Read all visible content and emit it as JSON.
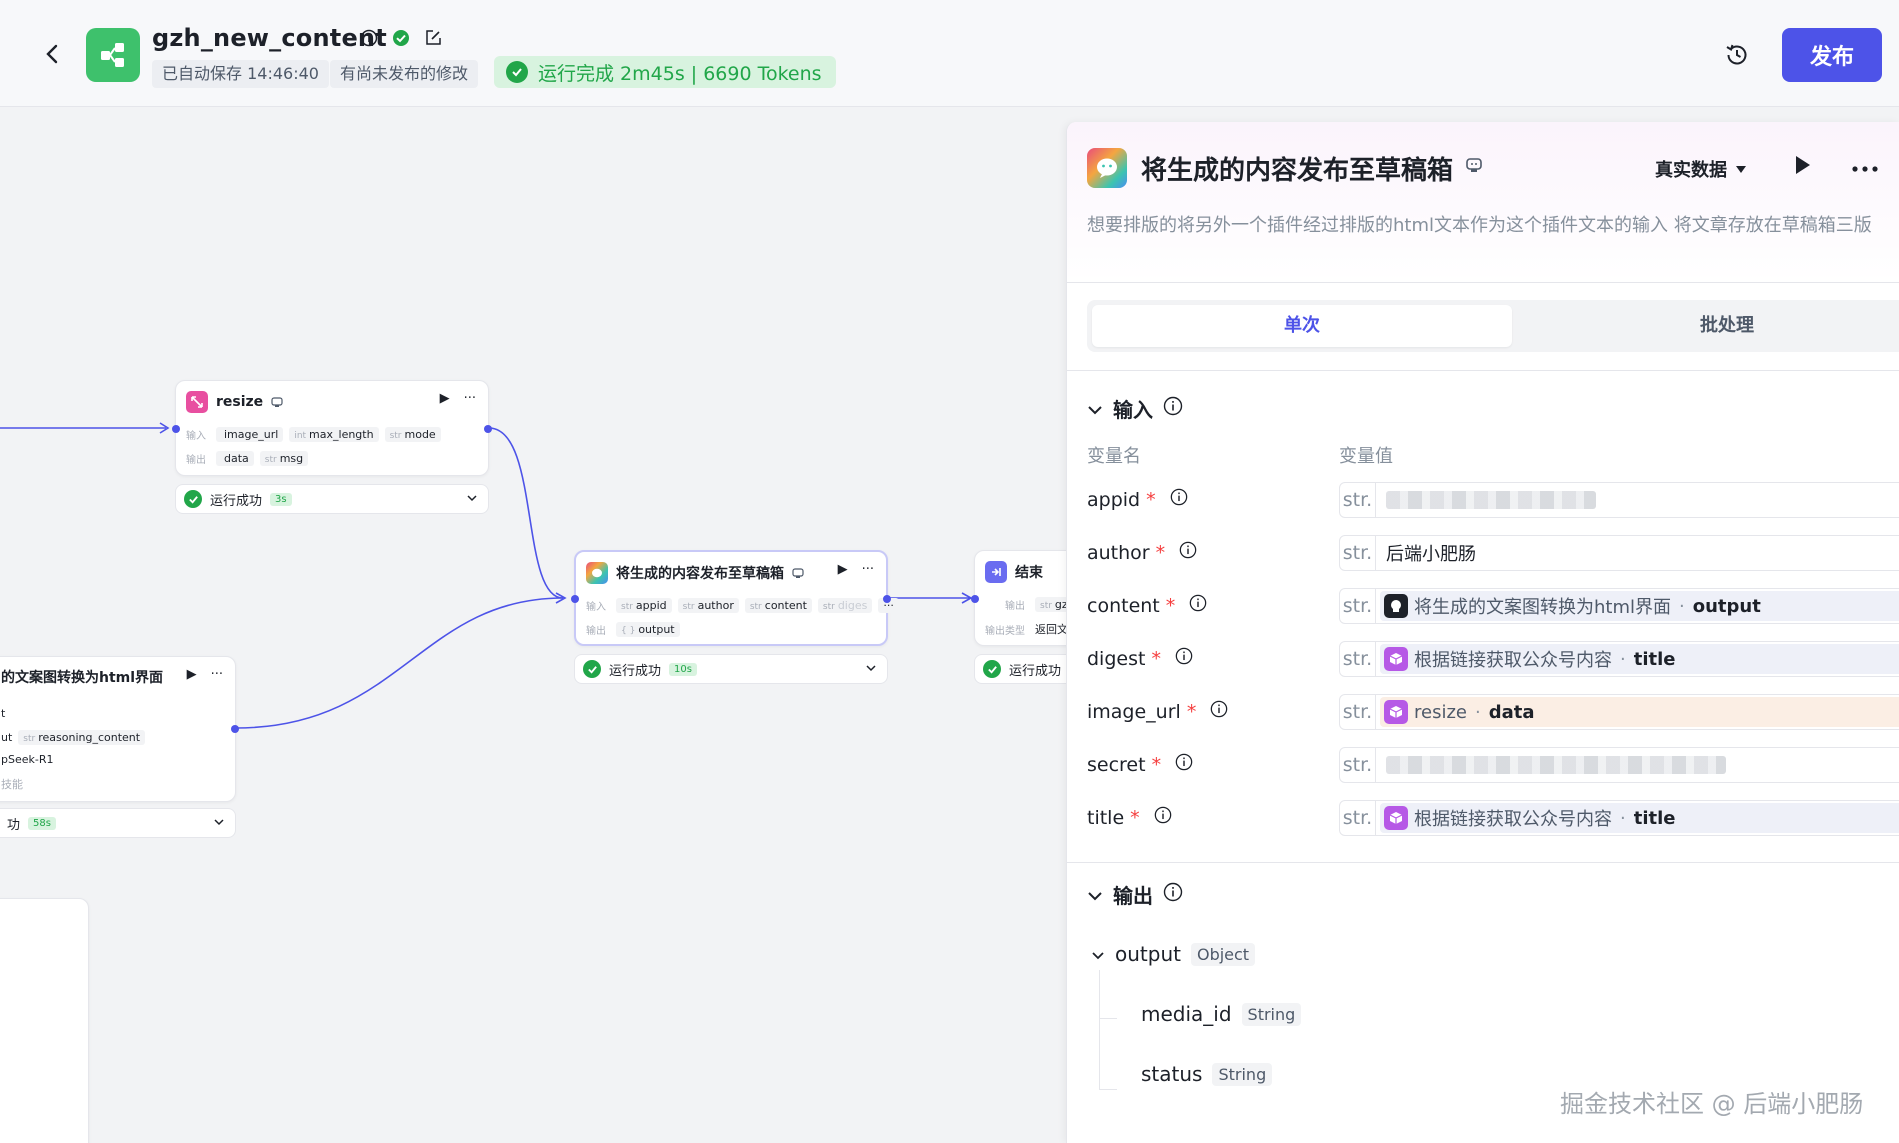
{
  "header": {
    "title": "gzh_new_content",
    "autosave": "已自动保存 14:46:40",
    "unpublished": "有尚未发布的修改",
    "run_status": "运行完成 2m45s | 6690 Tokens",
    "publish_label": "发布"
  },
  "nodes": {
    "resize": {
      "title": "resize",
      "input_label": "输入",
      "output_label": "输出",
      "inputs": [
        {
          "type": "",
          "name": "image_url"
        },
        {
          "type": "int",
          "name": "max_length"
        },
        {
          "type": "str",
          "name": "mode"
        }
      ],
      "outputs": [
        {
          "type": "",
          "name": "data"
        },
        {
          "type": "str",
          "name": "msg"
        }
      ],
      "status": "运行成功",
      "time": "3s"
    },
    "publish": {
      "title": "将生成的内容发布至草稿箱",
      "input_label": "输入",
      "output_label": "输出",
      "inputs": [
        {
          "type": "str",
          "name": "appid"
        },
        {
          "type": "str",
          "name": "author"
        },
        {
          "type": "str",
          "name": "content"
        },
        {
          "type": "str",
          "name": "diges"
        }
      ],
      "outputs": [
        {
          "type": "{ }",
          "name": "output"
        }
      ],
      "status": "运行成功",
      "time": "10s"
    },
    "end": {
      "title": "结束",
      "output_label": "输出",
      "output_pill": "gzh",
      "output_type_label": "输出类型",
      "output_type_value": "返回文",
      "status": "运行成功"
    },
    "html": {
      "title": "的文案图转换为html界面",
      "row1": "t",
      "row2_prefix": "ut",
      "row2_pill_type": "str",
      "row2_pill": "reasoning_content",
      "row3": "pSeek-R1",
      "row4": "技能",
      "status": "功",
      "time": "58s"
    }
  },
  "panel": {
    "title": "将生成的内容发布至草稿箱",
    "data_source": "真实数据",
    "description": "想要排版的将另外一个插件经过排版的html文本作为这个插件文本的输入 将文章存放在草稿箱三版",
    "tabs": [
      "单次",
      "批处理"
    ],
    "input_section": "输入",
    "col_name": "变量名",
    "col_value": "变量值",
    "variables": [
      {
        "name": "appid",
        "type": "str.",
        "kind": "blurred"
      },
      {
        "name": "author",
        "type": "str.",
        "kind": "text",
        "value": "后端小肥肠"
      },
      {
        "name": "content",
        "type": "str.",
        "kind": "ref",
        "source": "将生成的文案图转换为html界面",
        "field": "output",
        "icon": "llm"
      },
      {
        "name": "digest",
        "type": "str.",
        "kind": "ref",
        "source": "根据链接获取公众号内容",
        "field": "title",
        "icon": "plugin"
      },
      {
        "name": "image_url",
        "type": "str.",
        "kind": "ref",
        "source": "resize",
        "field": "data",
        "icon": "plugin",
        "warn": true
      },
      {
        "name": "secret",
        "type": "str.",
        "kind": "blurred"
      },
      {
        "name": "title",
        "type": "str.",
        "kind": "ref",
        "source": "根据链接获取公众号内容",
        "field": "title",
        "icon": "plugin"
      }
    ],
    "output_section": "输出",
    "outputs": {
      "name": "output",
      "type": "Object",
      "children": [
        {
          "name": "media_id",
          "type": "String"
        },
        {
          "name": "status",
          "type": "String"
        }
      ]
    }
  },
  "watermark": "掘金技术社区 @ 后端小肥肠",
  "colors": {
    "accent": "#4d53e8",
    "success": "#21a649",
    "required": "#f53f3f"
  }
}
